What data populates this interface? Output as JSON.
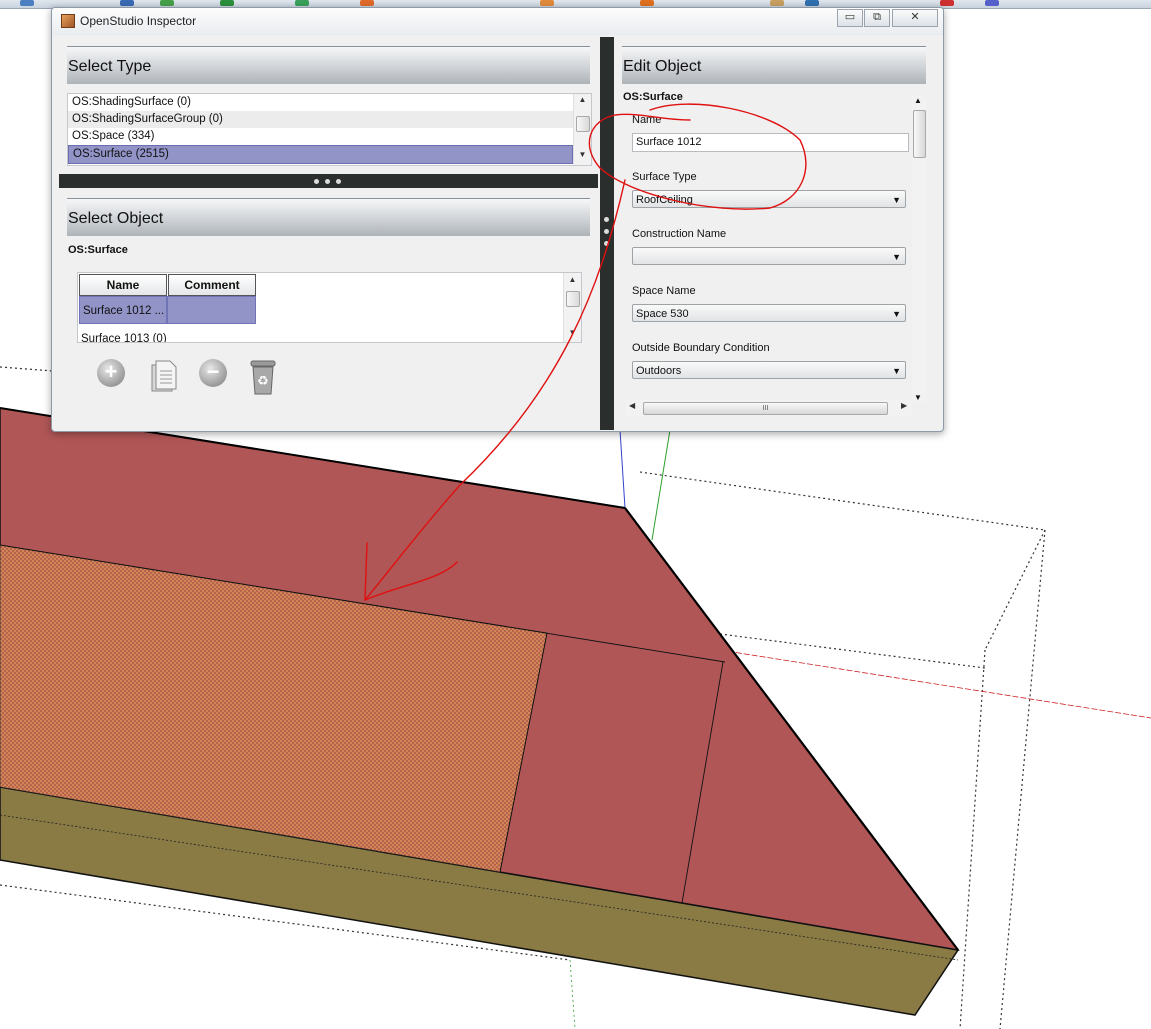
{
  "window": {
    "title": "OpenStudio Inspector",
    "buttons": [
      "▭",
      "⧉",
      "✕"
    ]
  },
  "select_type": {
    "header": "Select Type",
    "items": [
      {
        "label": "OS:ShadingSurface (0)",
        "selected": false
      },
      {
        "label": "OS:ShadingSurfaceGroup (0)",
        "selected": false
      },
      {
        "label": "OS:Space (334)",
        "selected": false
      },
      {
        "label": "OS:Surface (2515)",
        "selected": true
      }
    ]
  },
  "select_object": {
    "header": "Select Object",
    "subheader": "OS:Surface",
    "columns": [
      "Name",
      "Comment"
    ],
    "rows": [
      {
        "name": "Surface 1012 ...",
        "comment": "",
        "selected": true
      },
      {
        "name": "Surface 1013 (0)",
        "comment": "",
        "selected": false
      }
    ],
    "actions": [
      "add-icon",
      "copy-icon",
      "remove-icon",
      "purge-icon"
    ]
  },
  "edit_object": {
    "header": "Edit Object",
    "subheader": "OS:Surface",
    "fields": [
      {
        "label": "Name",
        "value": "Surface 1012",
        "type": "text"
      },
      {
        "label": "Surface Type",
        "value": "RoofCeiling",
        "type": "combo"
      },
      {
        "label": "Construction Name",
        "value": "",
        "type": "combo"
      },
      {
        "label": "Space Name",
        "value": "Space 530",
        "type": "combo"
      },
      {
        "label": "Outside Boundary Condition",
        "value": "Outdoors",
        "type": "combo"
      }
    ],
    "hscroll_grip": "III"
  },
  "colors": {
    "roof": "#b05656",
    "roof_selected_texture": "#c8764c",
    "wall": "#8a7a44",
    "selection_row": "#9294c8",
    "annotation": "#e01010"
  }
}
